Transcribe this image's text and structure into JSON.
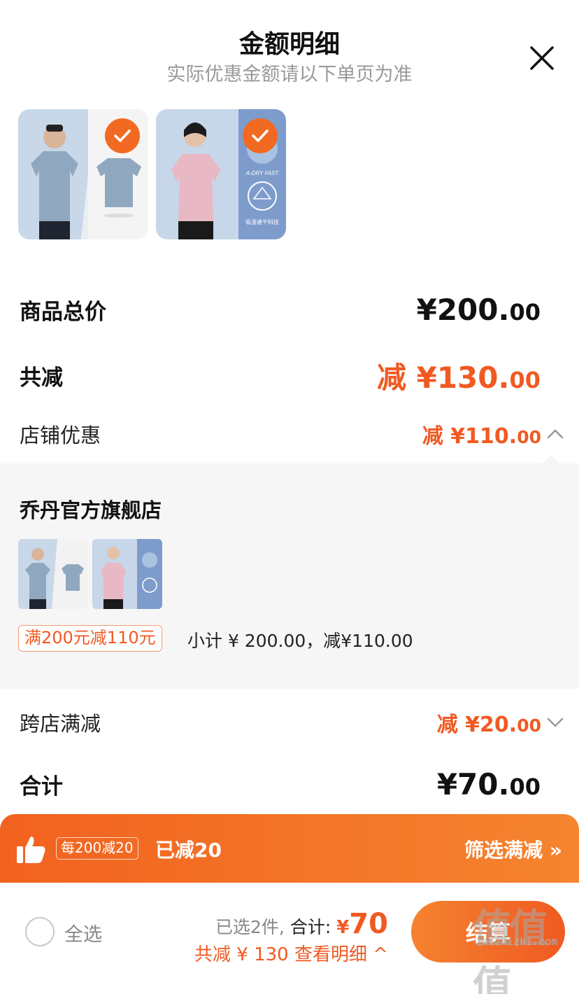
{
  "header": {
    "title": "金额明细",
    "subtitle": "实际优惠金额请以下单页为准",
    "close_icon": "close-icon"
  },
  "products": [
    {
      "name": "men-tshirt-blue",
      "checked": true,
      "label": "",
      "colors": {
        "shirt": "#8fa8bf",
        "bg": "#c9d8e8"
      }
    },
    {
      "name": "women-tshirt-pink",
      "checked": true,
      "label": "A-DRY FAST",
      "badge": "吸湿速干科技",
      "colors": {
        "shirt": "#e8b8c4",
        "bg": "#c7d6e8"
      }
    }
  ],
  "price": {
    "goods_total_label": "商品总价",
    "goods_total_main": "¥200.",
    "goods_total_cents": "00",
    "discount_label": "共减",
    "discount_main": "减 ¥130.",
    "discount_cents": "00",
    "store_discount_label": "店铺优惠",
    "store_discount_main": "减 ¥110.",
    "store_discount_cents": "00",
    "cross_store_label": "跨店满减",
    "cross_store_main": "减 ¥20.",
    "cross_store_cents": "00",
    "total_label": "合计",
    "total_main": "¥70.",
    "total_cents": "00"
  },
  "store": {
    "name": "乔丹官方旗舰店",
    "promo_tag": "满200元减110元",
    "promo_text": "小计 ¥ 200.00，减¥110.00"
  },
  "banner": {
    "tag": "每200减20",
    "done": "已减20",
    "filter": "筛选满减 »"
  },
  "footer": {
    "select_all": "全选",
    "selected_count": "已选2件,",
    "total_label": "合计:",
    "total_currency": "¥",
    "total_value": "70",
    "saved": "共减 ¥ 130   查看明细 ^",
    "checkout": "结算"
  },
  "watermark": {
    "big": "值值值",
    "small": "zhizhizhi.com"
  },
  "colors": {
    "accent": "#f05a22",
    "banner_start": "#f2621f",
    "banner_end": "#f5842f"
  }
}
